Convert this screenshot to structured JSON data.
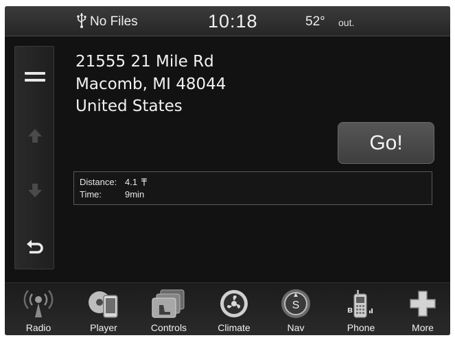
{
  "status_bar": {
    "media_status": "No Files",
    "time": "10:18",
    "outside_temp": "52°",
    "outside_label": "out."
  },
  "destination": {
    "address_line1": "21555 21 Mile Rd",
    "address_line2": "Macomb, MI 48044",
    "country": "United States",
    "go_label": "Go!"
  },
  "route_info": {
    "distance_label": "Distance:",
    "distance_value": "4.1",
    "time_label": "Time:",
    "time_value": "9min"
  },
  "dock": {
    "items": [
      {
        "label": "Radio",
        "icon": "radio-icon"
      },
      {
        "label": "Player",
        "icon": "player-icon"
      },
      {
        "label": "Controls",
        "icon": "controls-icon"
      },
      {
        "label": "Climate",
        "icon": "climate-icon"
      },
      {
        "label": "Nav",
        "icon": "nav-icon"
      },
      {
        "label": "Phone",
        "icon": "phone-icon"
      },
      {
        "label": "More",
        "icon": "more-icon"
      }
    ]
  }
}
